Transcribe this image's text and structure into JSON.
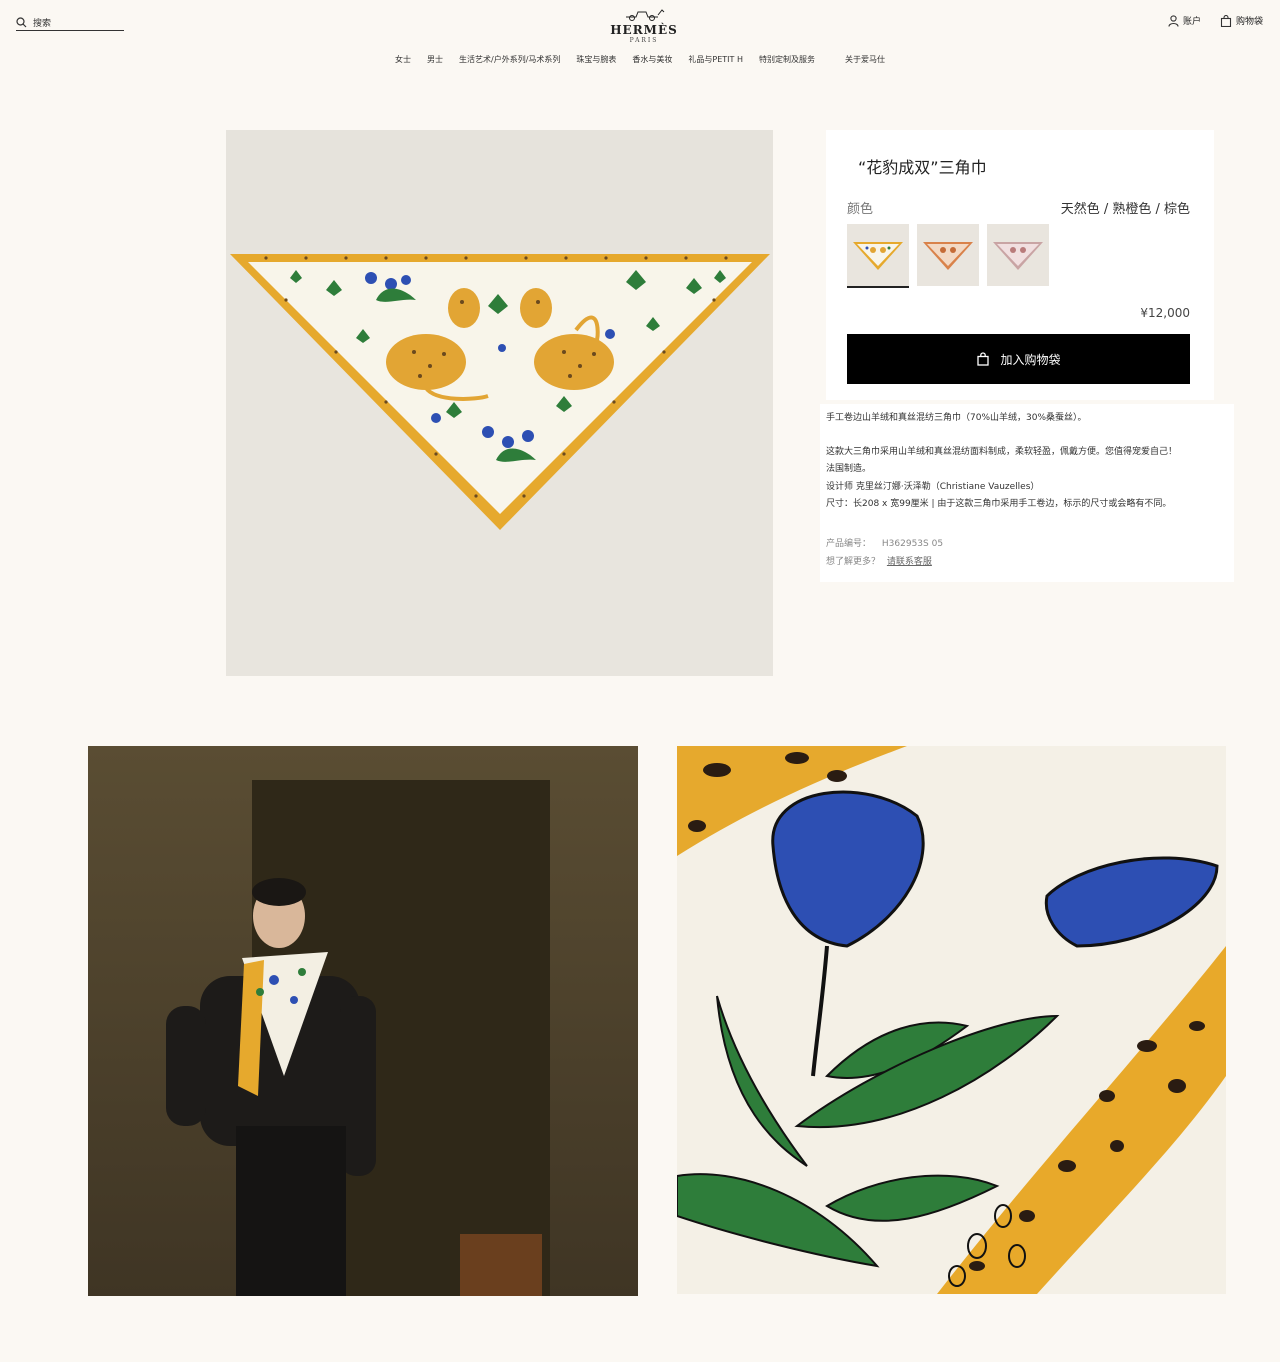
{
  "header": {
    "search_label": "搜索",
    "brand": "HERMÈS",
    "brand_city": "PARIS",
    "account_label": "账户",
    "bag_label": "购物袋"
  },
  "nav": {
    "items": [
      "女士",
      "男士",
      "生活艺术/户外系列/马术系列",
      "珠宝与腕表",
      "香水与美妆",
      "礼品与PETIT H",
      "特别定制及服务",
      "关于爱马仕"
    ]
  },
  "product": {
    "title": "“花豹成双”三角巾",
    "color_label": "颜色",
    "color_value": "天然色 / 熟橙色 / 棕色",
    "swatches": [
      "natural",
      "orange",
      "brown"
    ],
    "price": "¥12,000",
    "add_to_cart": "加入购物袋",
    "desc_line1": "手工卷边山羊绒和真丝混纺三角巾（70%山羊绒，30%桑蚕丝）。",
    "desc_line2": "这款大三角巾采用山羊绒和真丝混纺面料制成，柔软轻盈，佩戴方便。您值得宠爱自己！",
    "desc_line3": "法国制造。",
    "desc_line4": "设计师 克里丝汀娜·沃泽勒（Christiane Vauzelles）",
    "desc_line5": "尺寸：长208 x 宽99厘米 | 由于这款三角巾采用手工卷边，标示的尺寸或会略有不同。",
    "sku_label": "产品编号：",
    "sku_value": "H362953S 05",
    "more_label": "想了解更多？",
    "contact_link": "请联系客服"
  },
  "colors": {
    "background": "#fbf8f3",
    "cart_button": "#000000",
    "scarf_gold": "#e6a92d",
    "scarf_cream": "#f8f5ea",
    "flower_blue": "#2d4fb3",
    "leaf_green": "#2e7d3a"
  }
}
